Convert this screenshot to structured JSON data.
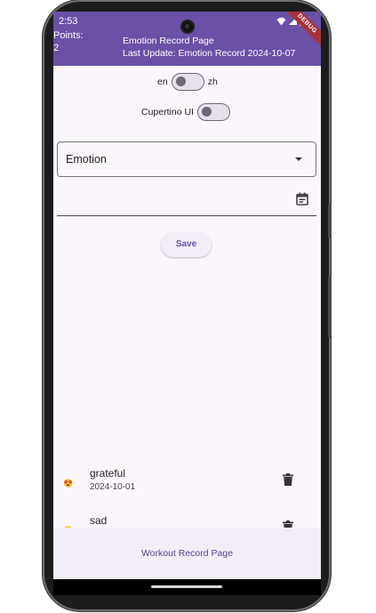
{
  "status_bar": {
    "time": "2:53"
  },
  "app_bar": {
    "points_label": "Points:",
    "points_value": "2",
    "title": "Emotion Record Page",
    "subtitle": "Last Update: Emotion Record 2024-10-07",
    "debug_banner": "DEBUG"
  },
  "language_toggle": {
    "left_label": "en",
    "right_label": "zh",
    "on": false
  },
  "cupertino_toggle": {
    "label": "Cupertino UI",
    "on": false
  },
  "emotion_dropdown": {
    "label": "Emotion"
  },
  "date_field": {
    "value": ""
  },
  "save_button": {
    "label": "Save"
  },
  "records": [
    {
      "emoji": "😍",
      "name": "grateful",
      "date": "2024-10-01"
    },
    {
      "emoji": "😢",
      "name": "sad",
      "date": ""
    }
  ],
  "bottom_bar": {
    "nav_label": "Workout Record Page"
  },
  "colors": {
    "primary": "#6a50a7",
    "background": "#fbf6fc",
    "bottom": "#f3edf7"
  },
  "icons": [
    "wifi-icon",
    "signal-icon",
    "battery-icon",
    "calendar-icon",
    "delete-icon"
  ]
}
